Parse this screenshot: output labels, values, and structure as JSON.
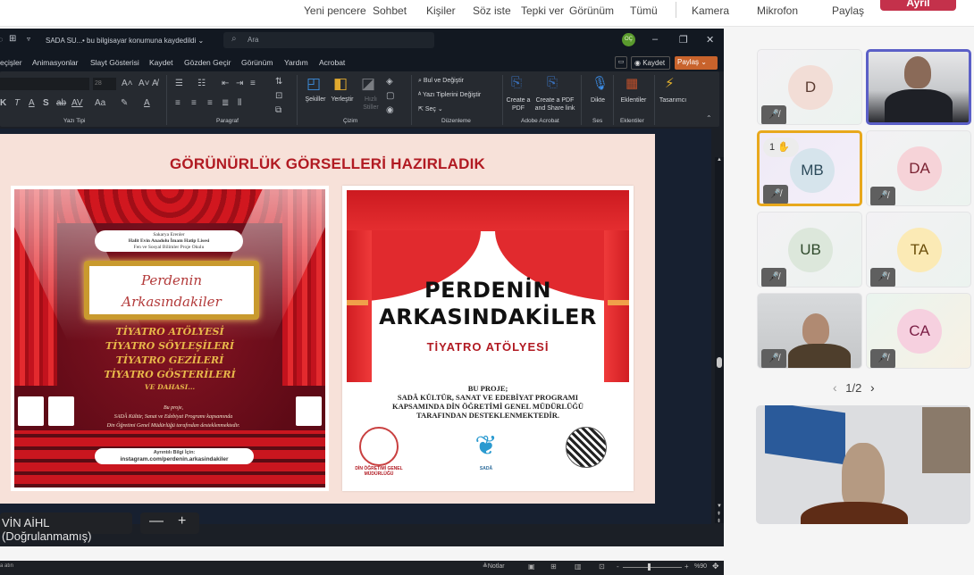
{
  "teams_bar": {
    "items": [
      "Yeni pencere",
      "Sohbet",
      "Kişiler",
      "Söz iste",
      "Tepki ver",
      "Görünüm",
      "Tümü",
      "Kamera",
      "Mikrofon",
      "Paylaş"
    ],
    "leave_label": "Ayrıl",
    "colors": {
      "leave": "#c4314b"
    }
  },
  "ppt": {
    "doc_title": "SADA SU...",
    "save_status": "• bu bilgisayar konumuna kaydedildi ⌄",
    "search_placeholder": "Ara",
    "user_initials": "OÇ",
    "menu": [
      "eçişler",
      "Animasyonlar",
      "Slayt Gösterisi",
      "Kaydet",
      "Gözden Geçir",
      "Görünüm",
      "Yardım",
      "Acrobat"
    ],
    "record_label": "◉ Kaydet",
    "share_label": "Paylaş ⌄",
    "ribbon": {
      "font_size": "28",
      "groups": [
        "Yazı Tipi",
        "Paragraf",
        "Çizim",
        "Düzenleme",
        "Adobe Acrobat",
        "Ses",
        "Eklentiler"
      ],
      "buttons": {
        "shapes": "Şekiller",
        "arrange": "Yerleştir",
        "quick_styles": "Hızlı Stiller",
        "find_replace": "Bul ve Değiştir",
        "replace_fonts": "Yazı Tiplerini Değiştir",
        "select": "Seç ⌄",
        "create_pdf": "Create a PDF",
        "create_share": "Create a PDF and Share link",
        "dictate": "Dikte",
        "addins": "Eklentiler",
        "designer": "Tasarımcı"
      }
    },
    "slide": {
      "title": "GÖRÜNÜRLÜK GÖRSELLERİ HAZIRLADIK",
      "poster1": {
        "school": [
          "Sakarya Erenler",
          "Halit Evin Anadolu İmam Hatip Lisesi",
          "Fen ve Sosyal Bilimler Proje Okulu"
        ],
        "marquee": [
          "Perdenin",
          "Arkasındakiler"
        ],
        "lines": [
          "TİYATRO ATÖLYESİ",
          "TİYATRO SÖYLEŞİLERİ",
          "TİYATRO GEZİLERİ",
          "TİYATRO GÖSTERİLERİ",
          "VE DAHASI..."
        ],
        "credit": [
          "Bu proje,",
          "SADÂ Kültür, Sanat ve Edebiyat Programı kapsamında",
          "Din Öğretimi Genel Müdürlüğü tarafından desteklenmektedir."
        ],
        "insta_label": "Ayrıntılı Bilgi İçin:",
        "insta_handle": "instagram.com/perdenin.arkasindakiler"
      },
      "poster2": {
        "title": [
          "PERDENİN",
          "ARKASINDAKİLER"
        ],
        "subtitle": "TİYATRO ATÖLYESİ",
        "project": [
          "BU PROJE;",
          "SADÂ KÜLTÜR, SANAT VE EDEBİYAT PROGRAMI",
          "KAPSAMINDA DİN ÖĞRETİMİ GENEL MÜDÜRLÜĞÜ",
          "TARAFINDAN DESTEKLENMEKTEDİR."
        ],
        "logos": [
          "DİN ÖĞRETİMİ GENEL MÜDÜRLÜĞÜ",
          "SADÂ",
          ""
        ]
      }
    },
    "presenter_name": "VİN AİHL (Doğrulanmamış)",
    "status_left": "a atın",
    "notes_label": "Notlar",
    "zoom_level": "%90"
  },
  "participants": {
    "tiles": [
      {
        "initials": "D",
        "bg": "#f2ddd6",
        "fg": "#5a3a30",
        "muted": true,
        "video": false
      },
      {
        "initials": "",
        "video": true,
        "active_speaker": true
      },
      {
        "initials": "MB",
        "bg": "#d6e4ec",
        "fg": "#2c4a5a",
        "muted": true,
        "video": false,
        "hand_raised": true,
        "hand_order": "1"
      },
      {
        "initials": "DA",
        "bg": "#f6d3d8",
        "fg": "#7a2232",
        "muted": true,
        "video": false
      },
      {
        "initials": "UB",
        "bg": "#dce7db",
        "fg": "#2f4a2c",
        "muted": true,
        "video": false
      },
      {
        "initials": "TA",
        "bg": "#fbeab5",
        "fg": "#6b4e0a",
        "muted": true,
        "video": false
      },
      {
        "initials": "",
        "video": true,
        "muted": true
      },
      {
        "initials": "CA",
        "bg": "#f6d0df",
        "fg": "#7a1d44",
        "muted": true,
        "video": false
      }
    ],
    "page": "1/2",
    "colors": {
      "active_speaker": "#5b5fc7",
      "hand_raised": "#e8a81c"
    }
  }
}
